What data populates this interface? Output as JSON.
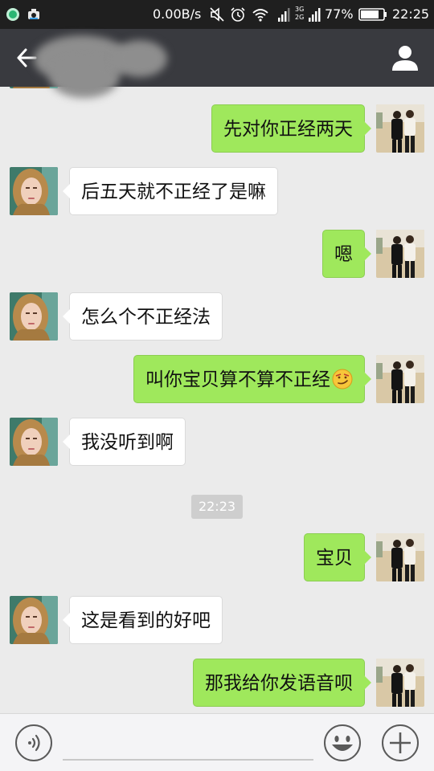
{
  "status_bar": {
    "network_speed": "0.00B/s",
    "network_type_top": "3G",
    "network_type_bottom": "2G",
    "battery_percent": "77%",
    "time": "22:25",
    "icons": [
      "app-notification-icon",
      "camera-notification-icon",
      "mute-icon",
      "alarm-icon",
      "wifi-icon",
      "signal-icon",
      "battery-icon"
    ]
  },
  "nav": {
    "title": "",
    "icons": [
      "back-arrow-icon",
      "person-icon"
    ]
  },
  "messages": [
    {
      "side": "right",
      "text": "先对你正经两天"
    },
    {
      "side": "left",
      "text": "后五天就不正经了是嘛"
    },
    {
      "side": "right",
      "text": "嗯"
    },
    {
      "side": "left",
      "text": "怎么个不正经法"
    },
    {
      "side": "right",
      "text": "叫你宝贝算不算不正经",
      "emoji": "smirk-emoji-icon"
    },
    {
      "side": "left",
      "text": "我没听到啊"
    },
    {
      "side": "right",
      "text": "宝贝"
    },
    {
      "side": "left",
      "text": "这是看到的好吧"
    },
    {
      "side": "right",
      "text": "那我给你发语音呗"
    }
  ],
  "timestamp": "22:23",
  "input_bar": {
    "placeholder": "",
    "icons": [
      "voice-icon",
      "emoji-icon",
      "plus-icon"
    ]
  },
  "colors": {
    "status_bar_bg": "#1f1f1f",
    "nav_bar_bg": "#393a3f",
    "chat_bg": "#ebebeb",
    "outgoing_bubble": "#9fe85c",
    "incoming_bubble": "#ffffff",
    "timestamp_bg": "#cecece"
  }
}
